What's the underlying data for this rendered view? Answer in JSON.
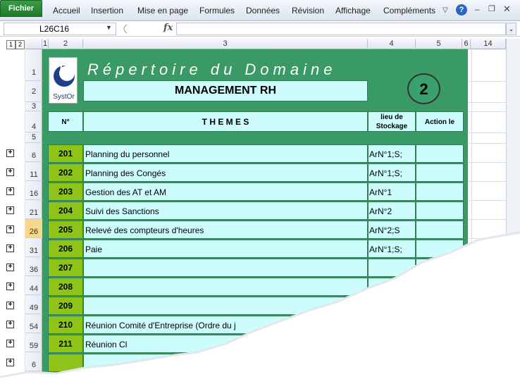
{
  "ribbon": {
    "file": "Fichier",
    "tabs": [
      "Accueil",
      "Insertion",
      "Mise en page",
      "Formules",
      "Données",
      "Révision",
      "Affichage",
      "Compléments"
    ]
  },
  "formula_bar": {
    "name_box": "L26C16",
    "fx": "fx",
    "value": ""
  },
  "outline_levels": [
    "1",
    "2"
  ],
  "columns": [
    "1",
    "2",
    "3",
    "4",
    "5",
    "6",
    "14"
  ],
  "rows": [
    "1",
    "2",
    "3",
    "4",
    "5",
    "6",
    "11",
    "16",
    "21",
    "26",
    "31",
    "36",
    "44",
    "49",
    "54",
    "59",
    "6"
  ],
  "sheet": {
    "title": "Répertoire du Domaine",
    "subtitle": "MANAGEMENT RH",
    "badge": "2",
    "logo_text": "SystOr",
    "headers": {
      "num": "N°",
      "themes": "T H E M E S",
      "storage": "lieu de Stockage",
      "action": "Action le"
    },
    "items": [
      {
        "num": "201",
        "theme": "Planning du personnel",
        "storage": "ArN°1;S;",
        "action": ""
      },
      {
        "num": "202",
        "theme": "Planning des Congés",
        "storage": "ArN°1;S;",
        "action": ""
      },
      {
        "num": "203",
        "theme": "Gestion des AT et AM",
        "storage": "ArN°1",
        "action": ""
      },
      {
        "num": "204",
        "theme": "Suivi des Sanctions",
        "storage": "ArN°2",
        "action": ""
      },
      {
        "num": "205",
        "theme": "Relevé des compteurs d'heures",
        "storage": "ArN°2;S",
        "action": ""
      },
      {
        "num": "206",
        "theme": "Paie",
        "storage": "ArN°1;S;",
        "action": ""
      },
      {
        "num": "207",
        "theme": "",
        "storage": "",
        "action": ""
      },
      {
        "num": "208",
        "theme": "",
        "storage": "",
        "action": ""
      },
      {
        "num": "209",
        "theme": "",
        "storage": "",
        "action": ""
      },
      {
        "num": "210",
        "theme": "Réunion Comité d'Entreprise (Ordre du j",
        "storage": "",
        "action": ""
      },
      {
        "num": "211",
        "theme": "Réunion Cl",
        "storage": "",
        "action": ""
      }
    ]
  },
  "colors": {
    "file_tab": "#1f7a2b",
    "sheet_green": "#3a9a66",
    "cell_cyan": "#ccfcfc",
    "num_green": "#8ec318",
    "active_row": "#f8d68a"
  }
}
